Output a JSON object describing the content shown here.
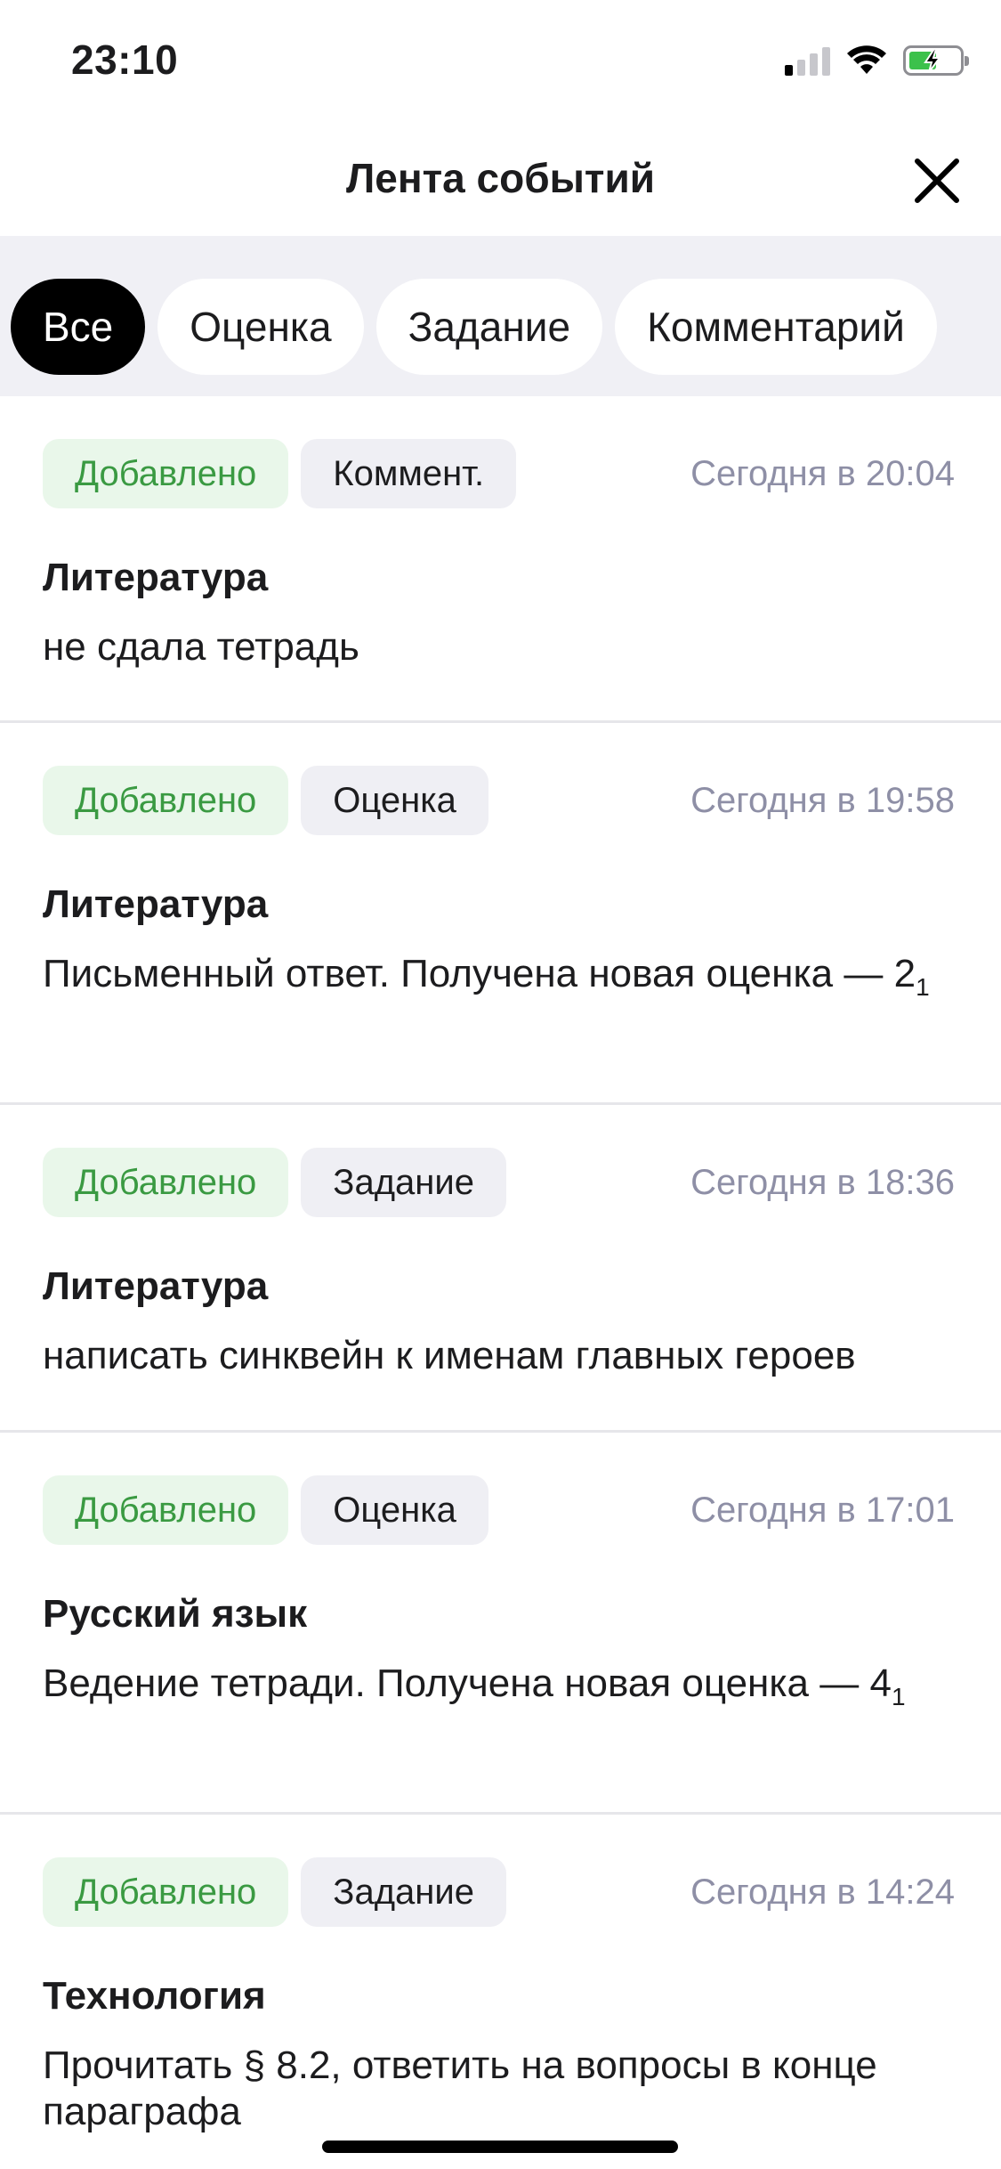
{
  "status_bar": {
    "time": "23:10"
  },
  "header": {
    "title": "Лента событий"
  },
  "filters": [
    "Все",
    "Оценка",
    "Задание",
    "Комментарий"
  ],
  "events": [
    {
      "status": "Добавлено",
      "type": "Коммент.",
      "time": "Сегодня в 20:04",
      "subject": "Литература",
      "text": "не сдала тетрадь",
      "sub": ""
    },
    {
      "status": "Добавлено",
      "type": "Оценка",
      "time": "Сегодня в 19:58",
      "subject": "Литература",
      "text": "Письменный ответ. Получена новая оценка — 2",
      "sub": "1"
    },
    {
      "status": "Добавлено",
      "type": "Задание",
      "time": "Сегодня в 18:36",
      "subject": "Литература",
      "text": "написать синквейн к именам главных героев",
      "sub": ""
    },
    {
      "status": "Добавлено",
      "type": "Оценка",
      "time": "Сегодня в 17:01",
      "subject": "Русский язык",
      "text": "Ведение тетради. Получена новая оценка — 4",
      "sub": "1"
    },
    {
      "status": "Добавлено",
      "type": "Задание",
      "time": "Сегодня в 14:24",
      "subject": "Технология",
      "text": "Прочитать § 8.2, ответить на вопросы в конце параграфа",
      "sub": ""
    }
  ],
  "colors": {
    "accent_green": "#3a9a42",
    "tag_green_bg": "#e9f7ea",
    "muted": "#8e8fa6"
  }
}
